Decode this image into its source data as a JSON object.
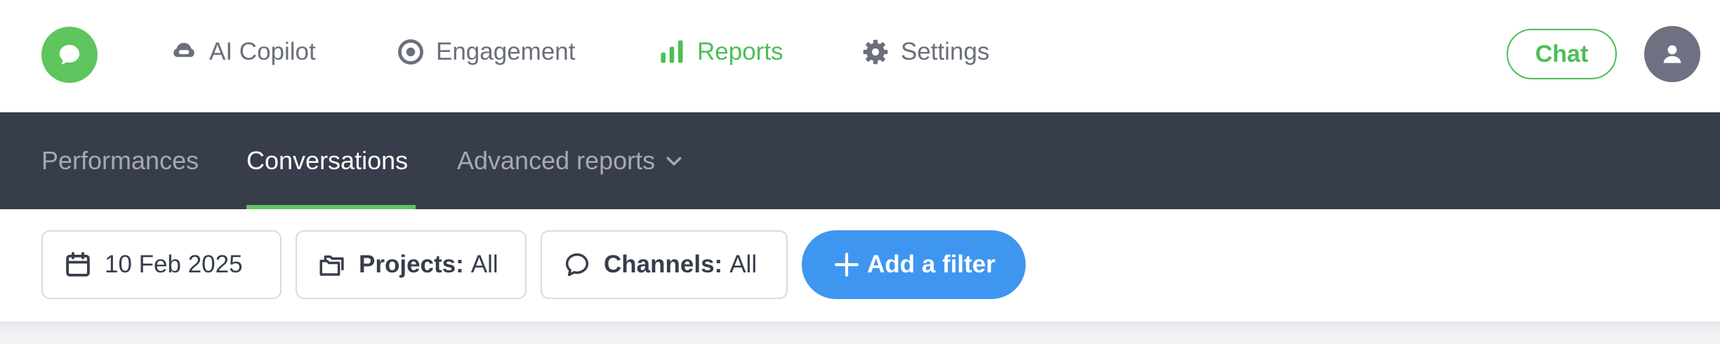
{
  "colors": {
    "brand_green": "#5fc55f",
    "active_green": "#4cbf55",
    "nav_text": "#6b6f7c",
    "subnav_bg": "#383d4b",
    "subnav_inactive": "#a6a9b3",
    "primary_blue": "#3f96f0"
  },
  "topnav": {
    "logo_icon": "chat-bubble-icon",
    "items": [
      {
        "label": "AI Copilot",
        "icon": "copilot-icon",
        "active": false
      },
      {
        "label": "Engagement",
        "icon": "target-icon",
        "active": false
      },
      {
        "label": "Reports",
        "icon": "bar-chart-icon",
        "active": true
      },
      {
        "label": "Settings",
        "icon": "gear-icon",
        "active": false
      }
    ],
    "chat_label": "Chat",
    "avatar_icon": "user-icon"
  },
  "subnav": {
    "tabs": [
      {
        "label": "Performances",
        "active": false
      },
      {
        "label": "Conversations",
        "active": true
      },
      {
        "label": "Advanced reports",
        "active": false,
        "dropdown": true
      }
    ]
  },
  "filters": {
    "date": {
      "value": "10 Feb 2025",
      "icon": "calendar-icon"
    },
    "projects": {
      "key": "Projects:",
      "value": "All",
      "icon": "folders-icon"
    },
    "channels": {
      "key": "Channels:",
      "value": "All",
      "icon": "chat-outline-icon"
    },
    "add_filter_label": "Add a filter"
  }
}
